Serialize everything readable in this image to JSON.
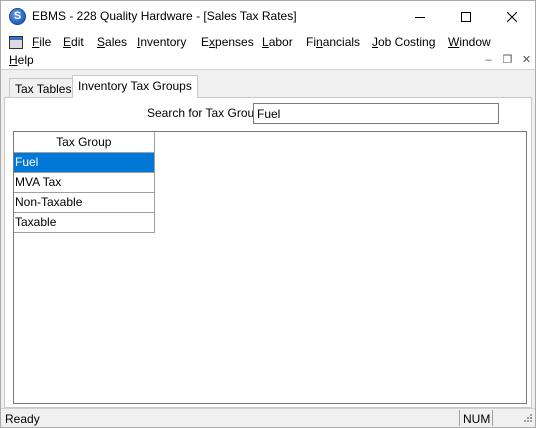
{
  "window": {
    "title": "EBMS - 228 Quality Hardware - [Sales Tax Rates]",
    "app_icon_letter": "S"
  },
  "menubar": {
    "items": [
      {
        "pre": "",
        "ul": "F",
        "post": "ile"
      },
      {
        "pre": "",
        "ul": "E",
        "post": "dit"
      },
      {
        "pre": "",
        "ul": "S",
        "post": "ales"
      },
      {
        "pre": "",
        "ul": "I",
        "post": "nventory"
      },
      {
        "pre": "E",
        "ul": "x",
        "post": "penses"
      },
      {
        "pre": "",
        "ul": "L",
        "post": "abor"
      },
      {
        "pre": "Fi",
        "ul": "n",
        "post": "ancials"
      },
      {
        "pre": "",
        "ul": "J",
        "post": "ob Costing"
      },
      {
        "pre": "",
        "ul": "W",
        "post": "indow"
      },
      {
        "pre": "",
        "ul": "H",
        "post": "elp"
      }
    ]
  },
  "tabs": [
    {
      "label": "Tax Tables",
      "active": false
    },
    {
      "label": "Inventory Tax Groups",
      "active": true
    }
  ],
  "search": {
    "label": "Search for Tax Group",
    "value": "Fuel"
  },
  "grid": {
    "column_header": "Tax Group",
    "rows": [
      "Fuel",
      "MVA Tax",
      "Non-Taxable",
      "Taxable"
    ],
    "selected_index": 0
  },
  "statusbar": {
    "status": "Ready",
    "num_indicator": "NUM"
  },
  "colors": {
    "selection": "#0078d7",
    "app_icon": "#1f5fbf"
  }
}
